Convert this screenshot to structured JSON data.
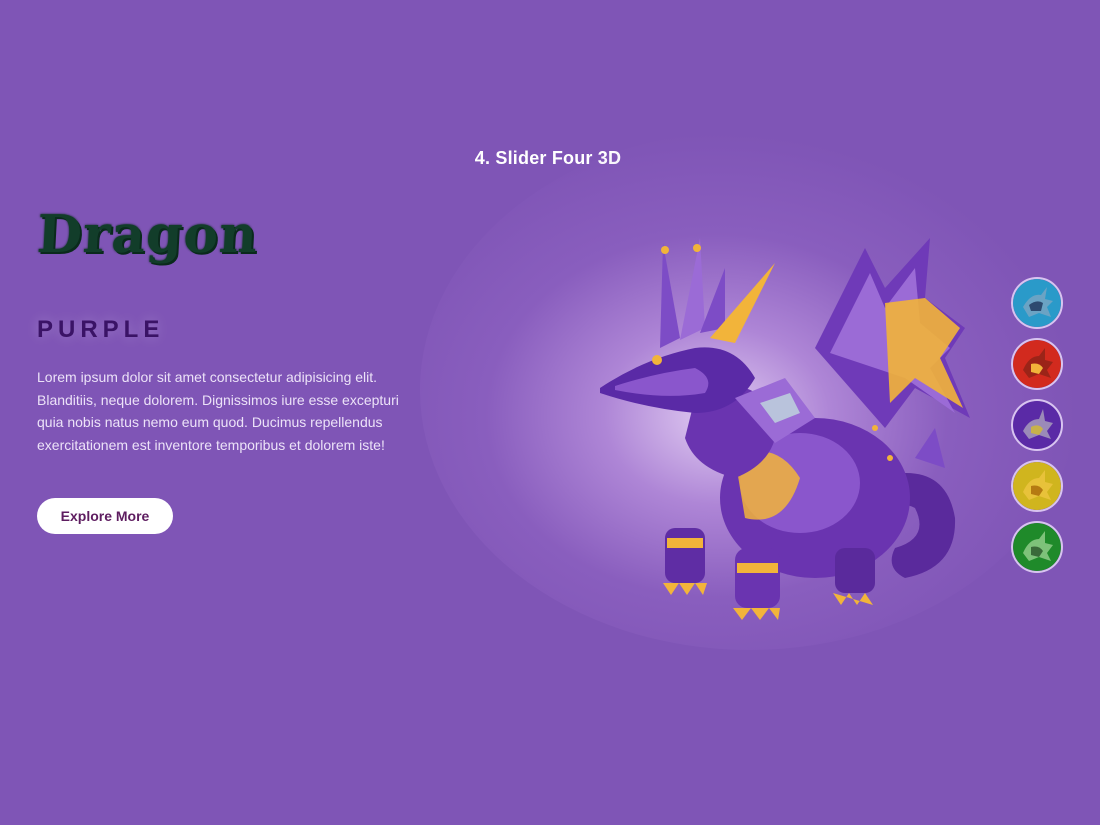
{
  "header": {
    "title": "4. Slider Four 3D"
  },
  "slide": {
    "brand": "Dragon",
    "variant": "PURPLE",
    "description": "Lorem ipsum dolor sit amet consectetur adipisicing elit. Blanditiis, neque dolorem. Dignissimos iure esse excepturi quia nobis natus nemo eum quod. Ducimus repellendus exercitationem est inventore temporibus et dolorem iste!",
    "cta_label": "Explore More",
    "hero_icon": "purple-dragon-figure"
  },
  "thumbnails": [
    {
      "icon": "teal-dragon-thumbnail",
      "color": "#2a9ac9"
    },
    {
      "icon": "red-dragon-thumbnail",
      "color": "#d22a1e"
    },
    {
      "icon": "purple-dragon-thumbnail",
      "color": "#5a2aa6"
    },
    {
      "icon": "yellow-dragon-thumbnail",
      "color": "#d0b51e"
    },
    {
      "icon": "green-dragon-thumbnail",
      "color": "#1f8a2a"
    }
  ],
  "colors": {
    "background": "#7f55b6",
    "brand_text": "#123d2a",
    "variant_text": "#3a1366",
    "button_bg": "#ffffff",
    "button_text": "#5e1d60",
    "accent_gold": "#f2b43a"
  }
}
